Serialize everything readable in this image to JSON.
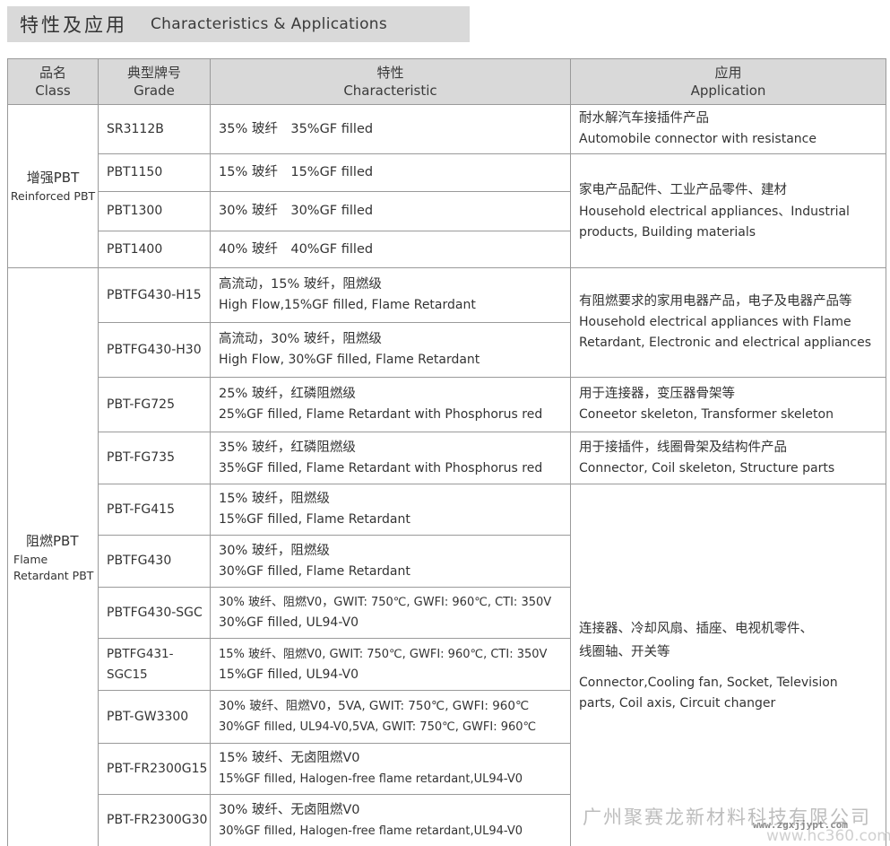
{
  "header": {
    "title_cn": "特性及应用",
    "title_en": "Characteristics & Applications"
  },
  "columns": [
    {
      "cn": "品名",
      "en": "Class"
    },
    {
      "cn": "典型牌号",
      "en": "Grade"
    },
    {
      "cn": "特性",
      "en": "Characteristic"
    },
    {
      "cn": "应用",
      "en": "Application"
    }
  ],
  "classes": [
    {
      "cn": "增强PBT",
      "en": "Reinforced PBT"
    },
    {
      "cn": "阻燃PBT",
      "en1": "Flame",
      "en2": "Retardant PBT"
    }
  ],
  "rows": [
    {
      "grade": "SR3112B",
      "char1": "35% 玻纤　35%GF filled",
      "char2": ""
    },
    {
      "grade": "PBT1150",
      "char1": "15% 玻纤　15%GF filled",
      "char2": ""
    },
    {
      "grade": "PBT1300",
      "char1": "30% 玻纤　30%GF filled",
      "char2": ""
    },
    {
      "grade": "PBT1400",
      "char1": "40% 玻纤　40%GF filled",
      "char2": ""
    },
    {
      "grade": "PBTFG430-H15",
      "char1": "高流动，15% 玻纤，阻燃级",
      "char2": "High Flow,15%GF filled, Flame Retardant"
    },
    {
      "grade": "PBTFG430-H30",
      "char1": "高流动，30% 玻纤，阻燃级",
      "char2": "High Flow, 30%GF filled, Flame Retardant"
    },
    {
      "grade": "PBT-FG725",
      "char1": "25% 玻纤，红磷阻燃级",
      "char2": "25%GF filled, Flame Retardant with Phosphorus red"
    },
    {
      "grade": "PBT-FG735",
      "char1": "35% 玻纤，红磷阻燃级",
      "char2": "35%GF filled, Flame Retardant with Phosphorus red"
    },
    {
      "grade": "PBT-FG415",
      "char1": "15% 玻纤，阻燃级",
      "char2": "15%GF filled, Flame Retardant"
    },
    {
      "grade": "PBTFG430",
      "char1": "30% 玻纤，阻燃级",
      "char2": "30%GF filled, Flame Retardant"
    },
    {
      "grade": "PBTFG430-SGC",
      "char1": "30% 玻纤、阻燃V0，GWIT: 750℃, GWFI: 960℃, CTI: 350V",
      "char2": "30%GF filled, UL94-V0"
    },
    {
      "grade": "PBTFG431-SGC15",
      "char1": "15% 玻纤、阻燃V0, GWIT: 750℃, GWFI: 960℃, CTI: 350V",
      "char2": "15%GF filled, UL94-V0"
    },
    {
      "grade": "PBT-GW3300",
      "char1": "30% 玻纤、阻燃V0，5VA, GWIT: 750℃, GWFI: 960℃",
      "char2": "30%GF filled, UL94-V0,5VA, GWIT: 750℃, GWFI: 960℃"
    },
    {
      "grade": "PBT-FR2300G15",
      "char1": "15% 玻纤、无卤阻燃V0",
      "char2": "15%GF filled, Halogen-free flame retardant,UL94-V0"
    },
    {
      "grade": "PBT-FR2300G30",
      "char1": "30% 玻纤、无卤阻燃V0",
      "char2": "30%GF filled, Halogen-free flame retardant,UL94-V0"
    }
  ],
  "applications": [
    {
      "cn": "耐水解汽车接插件产品",
      "en1": "Automobile connector with  resistance",
      "en2": ""
    },
    {
      "cn": "家电产品配件、工业产品零件、建材",
      "en1": "Household electrical appliances、Industrial",
      "en2": " products, Building materials"
    },
    {
      "cn": "有阻燃要求的家用电器产品，电子及电器产品等",
      "en1": "Household electrical appliances  with Flame",
      "en2": " Retardant, Electronic and electrical appliances"
    },
    {
      "cn": "用于连接器，变压器骨架等",
      "en1": "Coneetor skeleton, Transformer skeleton",
      "en2": ""
    },
    {
      "cn": "用于接插件，线圈骨架及结构件产品",
      "en1": "Connector, Coil skeleton, Structure parts",
      "en2": ""
    },
    {
      "cn": "连接器、冷却风扇、插座、电视机零件、",
      "cn2": "线圈轴、开关等",
      "en1": "Connector,Cooling fan, Socket, Television",
      "en2": " parts, Coil axis, Circuit changer"
    }
  ],
  "watermark": {
    "company": "广州聚赛龙新材料科技有限公司",
    "site1": "www.zgxjjypt.com",
    "site2": "www.hc360.com"
  }
}
